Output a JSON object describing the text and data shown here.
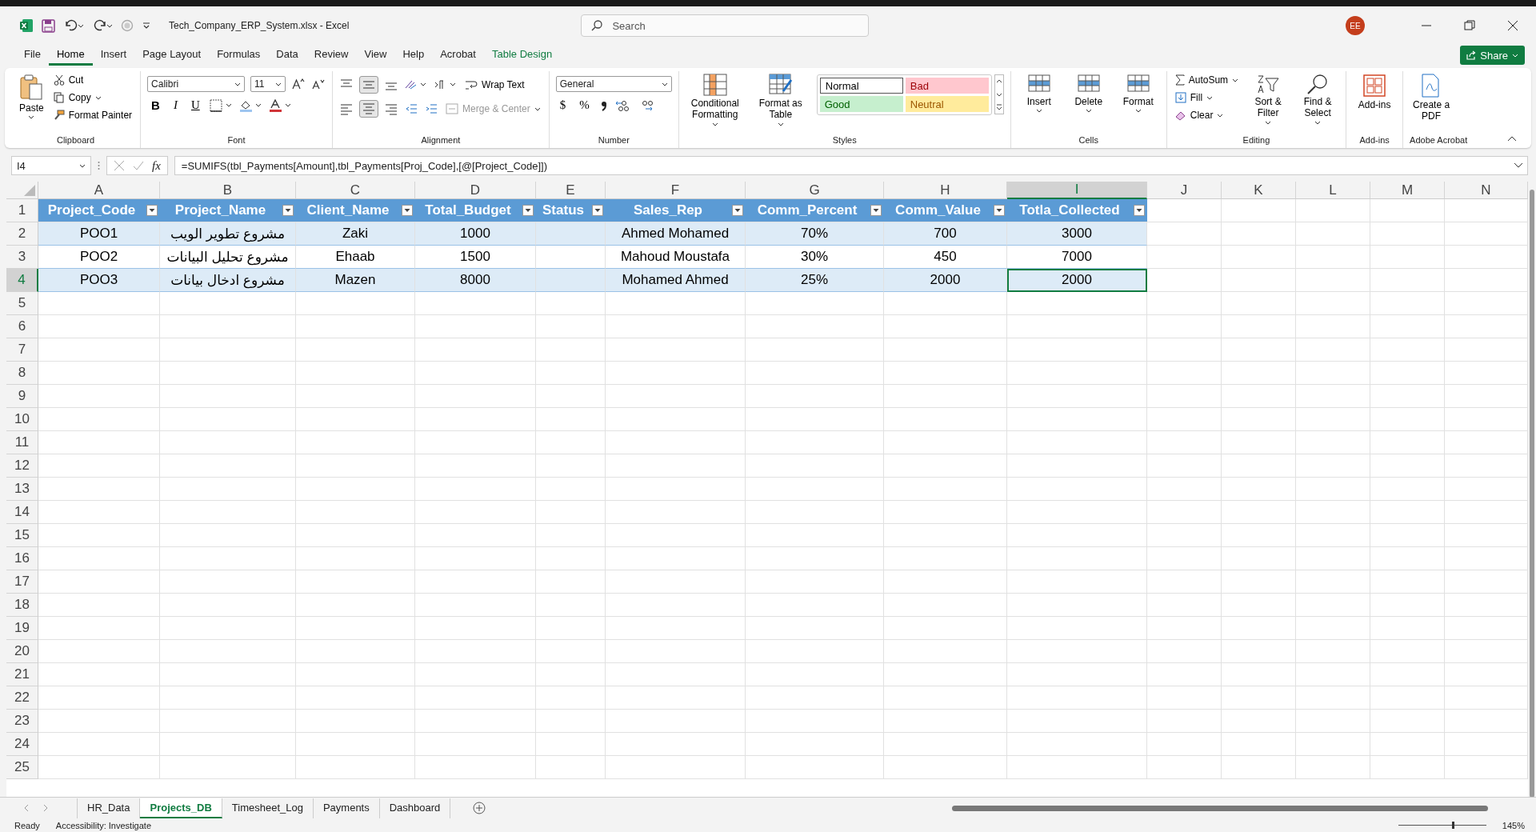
{
  "title_bar": {
    "title": "Tech_Company_ERP_System.xlsx  -  Excel",
    "search_placeholder": "Search",
    "avatar": "EE"
  },
  "menu_tabs": [
    {
      "label": "File",
      "selected": false
    },
    {
      "label": "Home",
      "selected": true
    },
    {
      "label": "Insert",
      "selected": false
    },
    {
      "label": "Page Layout",
      "selected": false
    },
    {
      "label": "Formulas",
      "selected": false
    },
    {
      "label": "Data",
      "selected": false
    },
    {
      "label": "Review",
      "selected": false
    },
    {
      "label": "View",
      "selected": false
    },
    {
      "label": "Help",
      "selected": false
    },
    {
      "label": "Acrobat",
      "selected": false
    },
    {
      "label": "Table Design",
      "selected": false,
      "kind": "contextual"
    }
  ],
  "share_button": "Share",
  "ribbon": {
    "clipboard": {
      "label": "Clipboard",
      "paste": "Paste",
      "cut": "Cut",
      "copy": "Copy",
      "format_painter": "Format Painter"
    },
    "font": {
      "label": "Font",
      "font_name": "Calibri",
      "font_size": "11",
      "bold": "B",
      "italic": "I",
      "underline": "U"
    },
    "alignment": {
      "label": "Alignment",
      "wrap_text": "Wrap Text",
      "merge_center": "Merge & Center"
    },
    "number": {
      "label": "Number",
      "format": "General",
      "currency": "$",
      "percent": "%"
    },
    "styles": {
      "label": "Styles",
      "conditional_formatting": "Conditional Formatting",
      "format_as_table": "Format as Table",
      "cell_styles": [
        {
          "label": "Normal",
          "color": "#ffffff"
        },
        {
          "label": "Bad",
          "color": "#ffc7ce"
        },
        {
          "label": "Good",
          "color": "#c6efce"
        },
        {
          "label": "Neutral",
          "color": "#ffeb9c"
        }
      ]
    },
    "cells": {
      "label": "Cells",
      "buttons": [
        "Insert",
        "Delete",
        "Format"
      ]
    },
    "editing": {
      "label": "Editing",
      "autosum": "AutoSum",
      "fill": "Fill",
      "clear": "Clear",
      "sort_filter": "Sort & Filter",
      "find_select": "Find & Select"
    },
    "addins": {
      "label": "Add-ins",
      "button": "Add-ins"
    },
    "acrobat": {
      "label": "Adobe Acrobat",
      "button": "Create a PDF"
    }
  },
  "formula_bar": {
    "name_box": "I4",
    "fx": "fx",
    "formula": "=SUMIFS(tbl_Payments[Amount],tbl_Payments[Proj_Code],[@[Project_Code]])"
  },
  "columns": [
    {
      "letter": "A",
      "selected": false
    },
    {
      "letter": "B",
      "selected": false
    },
    {
      "letter": "C",
      "selected": false
    },
    {
      "letter": "D",
      "selected": false
    },
    {
      "letter": "E",
      "selected": false
    },
    {
      "letter": "F",
      "selected": false
    },
    {
      "letter": "G",
      "selected": false
    },
    {
      "letter": "H",
      "selected": false
    },
    {
      "letter": "I",
      "selected": true
    },
    {
      "letter": "J",
      "selected": false
    },
    {
      "letter": "K",
      "selected": false
    },
    {
      "letter": "L",
      "selected": false
    },
    {
      "letter": "M",
      "selected": false
    },
    {
      "letter": "N",
      "selected": false
    }
  ],
  "row_numbers": [
    {
      "label": "1",
      "selected": false
    },
    {
      "label": "2",
      "selected": false
    },
    {
      "label": "3",
      "selected": false
    },
    {
      "label": "4",
      "selected": true
    },
    {
      "label": "5",
      "selected": false
    },
    {
      "label": "6",
      "selected": false
    },
    {
      "label": "7",
      "selected": false
    },
    {
      "label": "8",
      "selected": false
    },
    {
      "label": "9",
      "selected": false
    },
    {
      "label": "10",
      "selected": false
    },
    {
      "label": "11",
      "selected": false
    },
    {
      "label": "12",
      "selected": false
    },
    {
      "label": "13",
      "selected": false
    },
    {
      "label": "14",
      "selected": false
    },
    {
      "label": "15",
      "selected": false
    },
    {
      "label": "16",
      "selected": false
    },
    {
      "label": "17",
      "selected": false
    },
    {
      "label": "18",
      "selected": false
    },
    {
      "label": "19",
      "selected": false
    },
    {
      "label": "20",
      "selected": false
    },
    {
      "label": "21",
      "selected": false
    },
    {
      "label": "22",
      "selected": false
    },
    {
      "label": "23",
      "selected": false
    },
    {
      "label": "24",
      "selected": false
    },
    {
      "label": "25",
      "selected": false
    }
  ],
  "table": {
    "headers": [
      "Project_Code",
      "Project_Name",
      "Client_Name",
      "Total_Budget",
      "Status",
      "Sales_Rep",
      "Comm_Percent",
      "Comm_Value",
      "Totla_Collected"
    ],
    "rows": [
      [
        "POO1",
        "مشروع تطوير الويب",
        "Zaki",
        "1000",
        null,
        "Ahmed Mohamed",
        "70%",
        "700",
        "3000"
      ],
      [
        "POO2",
        "مشروع تحليل البيانات",
        "Ehaab",
        "1500",
        null,
        "Mahoud Moustafa",
        "30%",
        "450",
        "7000"
      ],
      [
        "POO3",
        "مشروع ادخال بيانات",
        "Mazen",
        "8000",
        null,
        "Mohamed Ahmed",
        "25%",
        "2000",
        "2000"
      ]
    ]
  },
  "sheet_tabs": [
    {
      "label": "HR_Data",
      "selected": false
    },
    {
      "label": "Projects_DB",
      "selected": true
    },
    {
      "label": "Timesheet_Log",
      "selected": false
    },
    {
      "label": "Payments",
      "selected": false
    },
    {
      "label": "Dashboard",
      "selected": false
    }
  ],
  "status_bar": {
    "status": "Ready",
    "accessibility": "Accessibility: Investigate",
    "zoom": "145%",
    "zoom_slider": {
      "level": 0.62
    }
  }
}
